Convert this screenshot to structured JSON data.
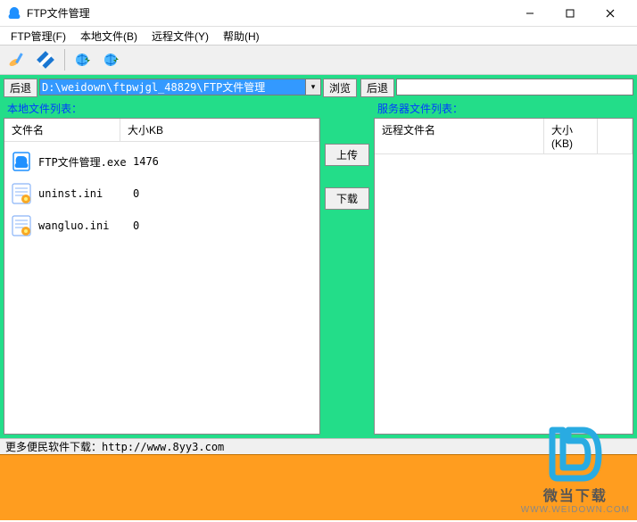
{
  "window": {
    "title": "FTP文件管理"
  },
  "menu": {
    "ftp": "FTP管理(F)",
    "local": "本地文件(B)",
    "remote": "远程文件(Y)",
    "help": "帮助(H)"
  },
  "buttons": {
    "back": "后退",
    "browse": "浏览",
    "upload": "上传",
    "download": "下载"
  },
  "paths": {
    "local": "D:\\weidown\\ftpwjgl_48829\\FTP文件管理",
    "remote": ""
  },
  "labels": {
    "local_list": "本地文件列表：",
    "remote_list": "服务器文件列表："
  },
  "local_table": {
    "col_name": "文件名",
    "col_size": "大小KB",
    "files": [
      {
        "name": "FTP文件管理.exe",
        "size": "1476",
        "icon": "exe"
      },
      {
        "name": "uninst.ini",
        "size": "0",
        "icon": "ini"
      },
      {
        "name": "wangluo.ini",
        "size": "0",
        "icon": "ini"
      }
    ]
  },
  "remote_table": {
    "col_name": "远程文件名",
    "col_size": "大小(KB)"
  },
  "status": "更多便民软件下载：http://www.8yy3.com",
  "watermark": {
    "line1": "微当下载",
    "line2": "WWW.WEIDOWN.COM"
  }
}
